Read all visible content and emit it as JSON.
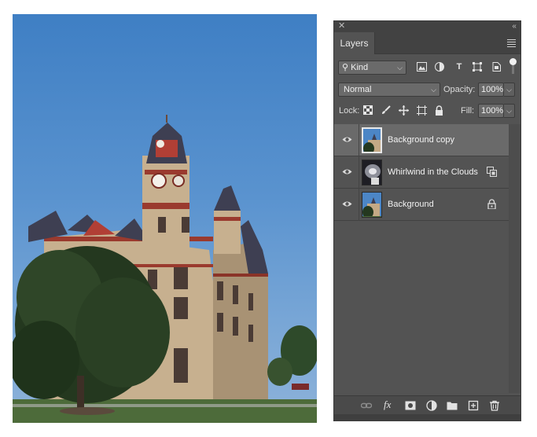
{
  "panel": {
    "tab_label": "Layers",
    "filter": {
      "kind_label": "Kind"
    },
    "blend": {
      "mode": "Normal",
      "opacity_label": "Opacity:",
      "opacity_value": "100%"
    },
    "lock": {
      "lock_label": "Lock:",
      "fill_label": "Fill:",
      "fill_value": "100%"
    },
    "layers": [
      {
        "name": "Background copy",
        "selected": true,
        "badge": ""
      },
      {
        "name": "Whirlwind in the Clouds",
        "selected": false,
        "badge": "smart-object-icon"
      },
      {
        "name": "Background",
        "selected": false,
        "badge": "lock-icon"
      }
    ],
    "bottom_icons": [
      "link-icon",
      "fx-icon",
      "mask-icon",
      "adjustment-icon",
      "folder-icon",
      "new-layer-icon",
      "trash-icon"
    ]
  },
  "colors": {
    "panel_bg": "#535353",
    "selected_layer": "#6a6a6a"
  }
}
